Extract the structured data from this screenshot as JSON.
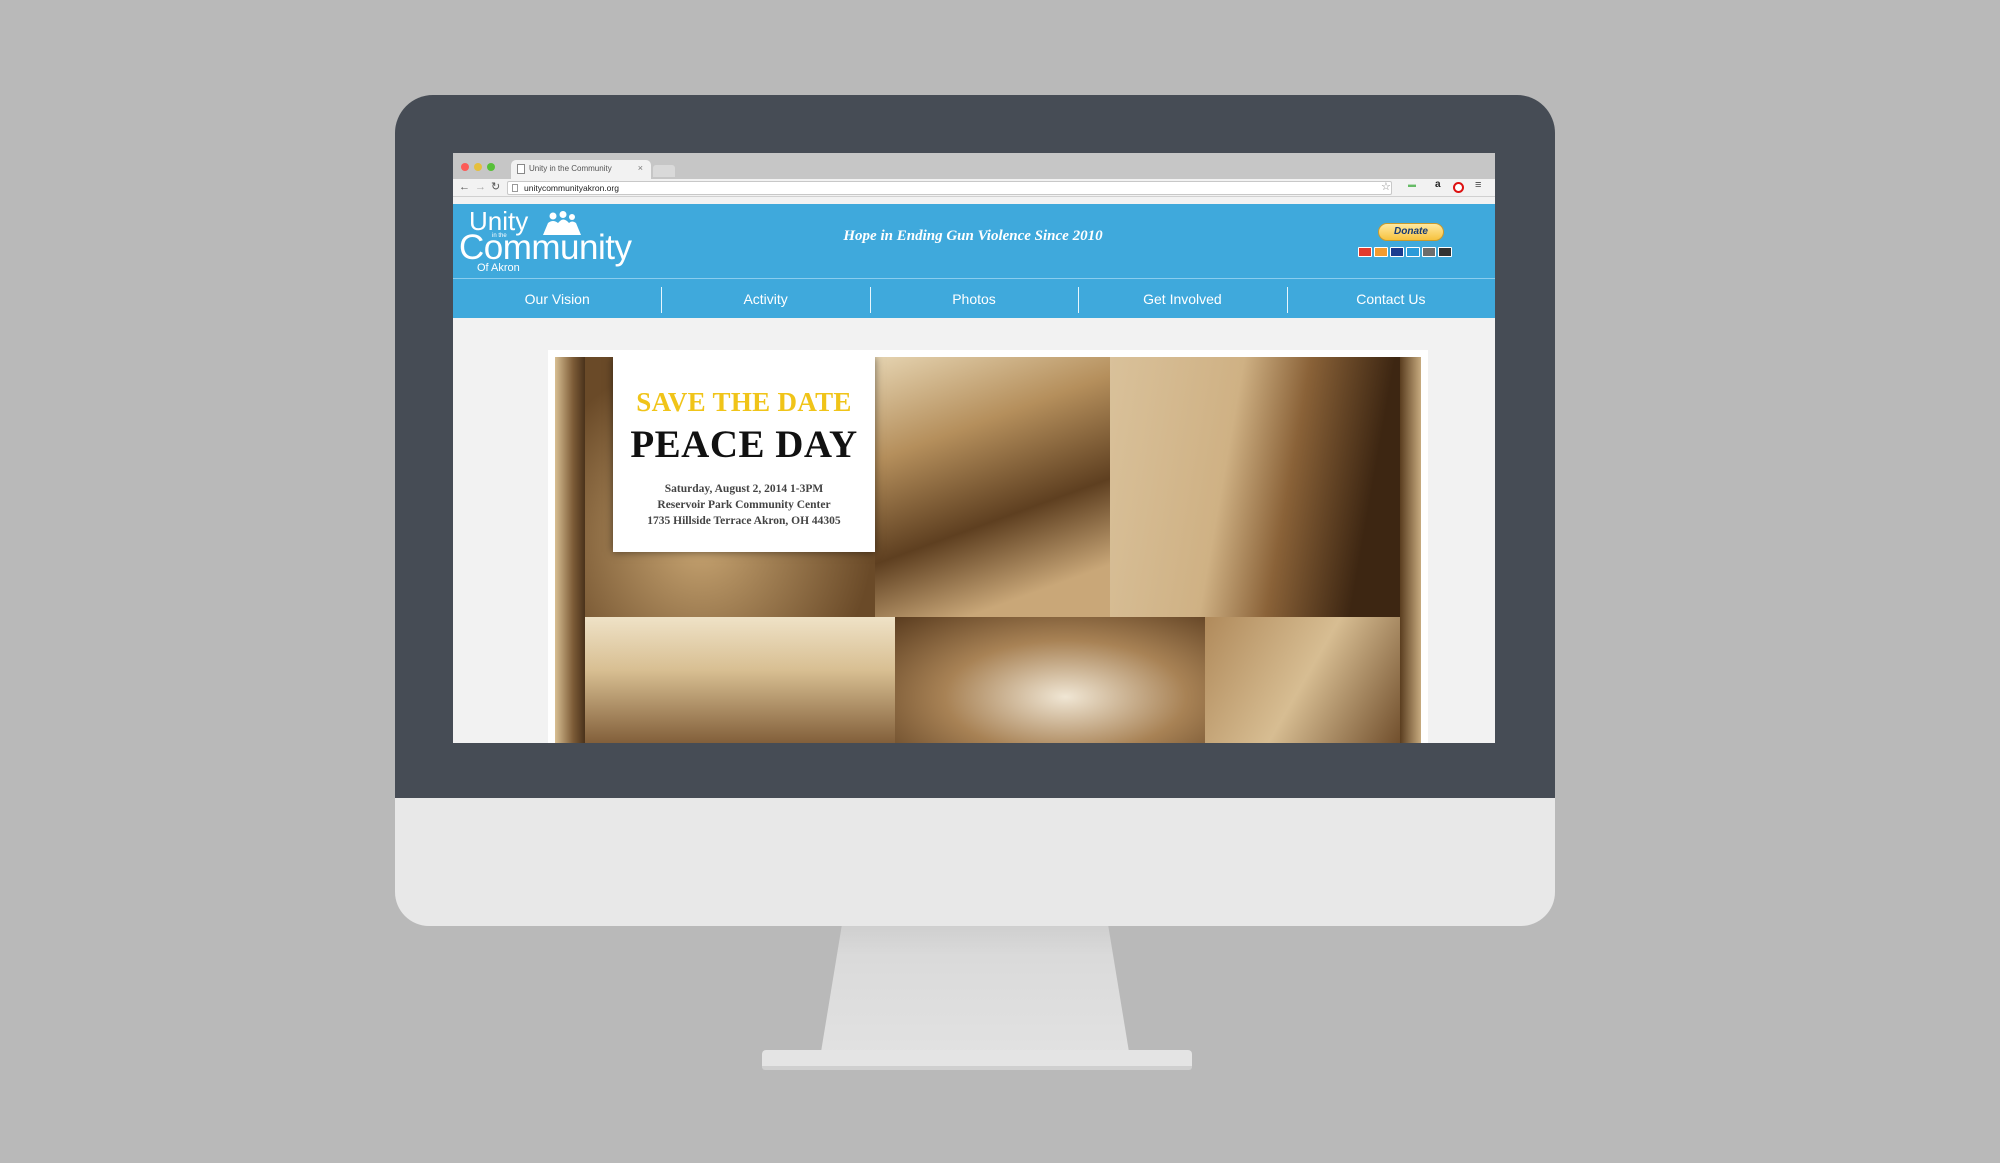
{
  "browser": {
    "tab_title": "Unity in the Community",
    "tab_close": "×",
    "url": "unitycommunityakron.org",
    "ext_amazon": "a"
  },
  "site": {
    "logo": {
      "unity": "Unity",
      "in_the": "in the",
      "community": "Community",
      "of_akron": "Of Akron"
    },
    "tagline": "Hope in Ending Gun Violence Since 2010",
    "donate_label": "Donate",
    "nav": [
      "Our Vision",
      "Activity",
      "Photos",
      "Get Involved",
      "Contact Us"
    ]
  },
  "banner": {
    "kicker": "SAVE THE DATE",
    "headline": "PEACE DAY",
    "date_line": "Saturday, August 2, 2014 1-3PM",
    "venue_line": "Reservoir Park Community Center",
    "address_line": "1735 Hillside Terrace Akron, OH 44305"
  },
  "colors": {
    "site_blue": "#3fa9dc",
    "bezel": "#464c55",
    "save_the_date_yellow": "#f0c419"
  },
  "icons": [
    "back-arrow-icon",
    "forward-arrow-icon",
    "reload-icon",
    "bookmark-star-icon",
    "menu-icon"
  ]
}
